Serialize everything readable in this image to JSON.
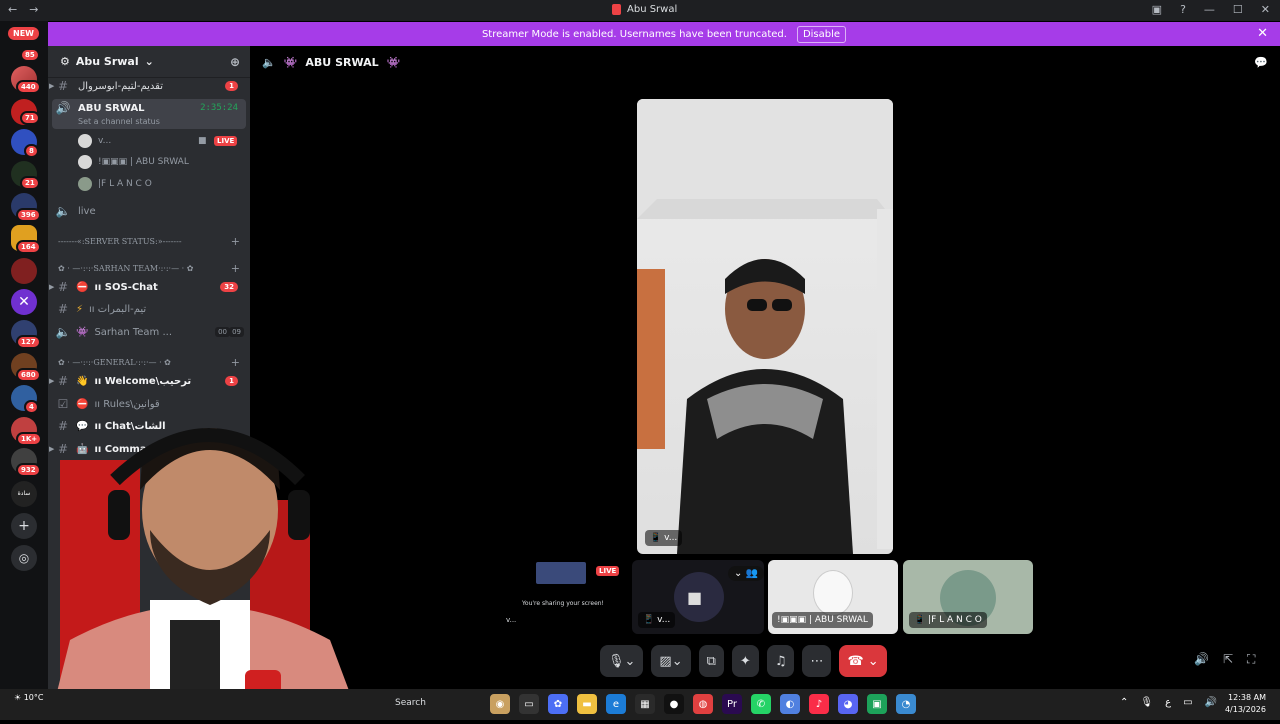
{
  "window": {
    "title": "Abu Srwal"
  },
  "banner": {
    "text": "Streamer Mode is enabled. Usernames have been truncated.",
    "button": "Disable"
  },
  "guilds": {
    "new_label": "NEW",
    "badges": [
      "85",
      "440",
      "71",
      "8",
      "21",
      "396",
      "164",
      "127",
      "680",
      "4",
      "1K+",
      "932"
    ],
    "sada_label": "سادة\nSADA"
  },
  "server": {
    "name": "Abu Srwal"
  },
  "channels": {
    "top": {
      "name": "تقديم-لتيم-ابوسروال",
      "count": "1"
    },
    "voice_active": {
      "name": "ABU SRWAL",
      "timer": "2:35:24",
      "status": "Set a channel status"
    },
    "voice_users": [
      {
        "name": "v...",
        "live": "LIVE"
      },
      {
        "name": "!▣▣▣ | ABU SRWAL"
      },
      {
        "name": "|F L A N C O"
      }
    ],
    "live_channel": "live",
    "cat_server_status": "-------«:SERVER STATUS:»-------",
    "cat_sarhan": "✿ · —·:·:·SARHAN TEAM·:·:·— · ✿",
    "sos": {
      "name": "ıı SOS-Chat",
      "count": "32"
    },
    "team": {
      "name": "ıı تيم-البمرات"
    },
    "sarhan_voice": {
      "name": "Sarhan Team ...",
      "a": "00",
      "b": "09"
    },
    "cat_general": "✿ · —·:·:·GENERAL·:·:·— · ✿",
    "welcome": {
      "name": "ıı Welcome\\ترحيب",
      "count": "1"
    },
    "rules": {
      "name": "ıı Rules\\قوانين"
    },
    "chat": {
      "name": "ıı Chat\\الشات"
    },
    "commands": {
      "name": "ıı Commands\\اوامر"
    }
  },
  "call": {
    "channel_title": "ABU SRWAL",
    "main_label": "v...",
    "tiles": [
      {
        "label": "v...",
        "live": "LIVE",
        "sharing": "You're sharing your screen!"
      },
      {
        "label": "v..."
      },
      {
        "label": "!▣▣▣ | ABU SRWAL"
      },
      {
        "label": "|F L A N C O"
      }
    ]
  },
  "taskbar": {
    "search": "Search",
    "time": "12:38 AM",
    "date": "4/13/2026",
    "weather": "10°C"
  }
}
